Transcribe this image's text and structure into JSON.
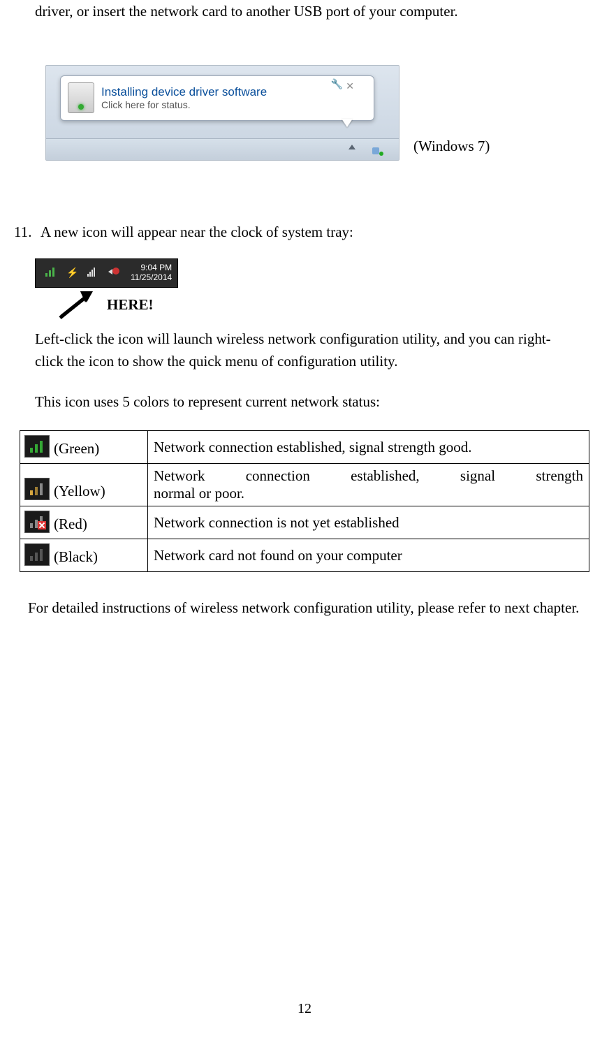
{
  "intro_para": "driver, or insert the network card to another USB port of your computer.",
  "notification": {
    "title": "Installing device driver software",
    "subtitle": "Click here for status.",
    "close": "✕",
    "wrench": "🔧"
  },
  "caption_os": "(Windows 7)",
  "step11": {
    "num": "11.",
    "text": "A new icon will appear near the clock of system tray:"
  },
  "systray": {
    "time": "9:04 PM",
    "date": "11/25/2014"
  },
  "here_label": "HERE!",
  "desc_para1": "Left-click the icon will launch wireless network configuration utility, and you can right-click the icon to show the quick menu of configuration utility.",
  "desc_para2": "This icon uses 5 colors to represent current network status:",
  "table": {
    "rows": [
      {
        "color": "(Green)",
        "desc": "Network connection established, signal strength good."
      },
      {
        "color": "(Yellow)",
        "desc_line1": "Network connection established, signal strength",
        "desc_line2": "normal or poor."
      },
      {
        "color": "(Red)",
        "desc": "Network connection is not yet established"
      },
      {
        "color": "(Black)",
        "desc": "Network card not found on your computer"
      }
    ]
  },
  "footer_para": "For detailed instructions of wireless network configuration utility, please refer to next chapter.",
  "pagenum": "12"
}
